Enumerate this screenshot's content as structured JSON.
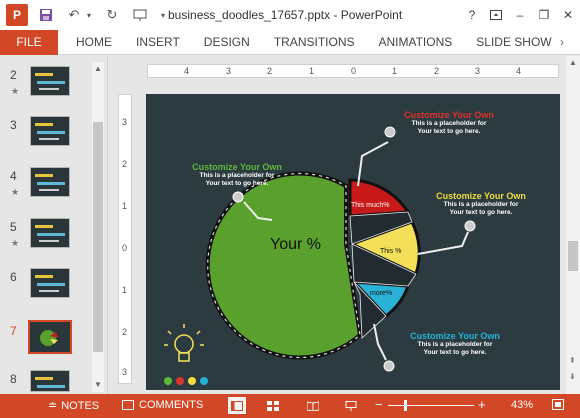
{
  "app": {
    "logo_letter": "P",
    "document_title": "business_doodles_17657.pptx - PowerPoint"
  },
  "window": {
    "help": "?",
    "minimize": "–",
    "restore": "❐",
    "close": "✕"
  },
  "ribbon": {
    "file": "FILE",
    "tabs": [
      "HOME",
      "INSERT",
      "DESIGN",
      "TRANSITIONS",
      "ANIMATIONS",
      "SLIDE SHOW"
    ],
    "more": "›"
  },
  "thumbnails": [
    {
      "number": "2",
      "star": "★"
    },
    {
      "number": "3",
      "star": ""
    },
    {
      "number": "4",
      "star": "★"
    },
    {
      "number": "5",
      "star": "★"
    },
    {
      "number": "6",
      "star": ""
    },
    {
      "number": "7",
      "star": ""
    },
    {
      "number": "8",
      "star": ""
    }
  ],
  "active_slide": "7",
  "ruler": {
    "horizontal": [
      "4",
      "3",
      "2",
      "1",
      "0",
      "1",
      "2",
      "3",
      "4"
    ],
    "vertical": [
      "3",
      "2",
      "1",
      "0",
      "1",
      "2",
      "3"
    ]
  },
  "slide": {
    "center_label": "Your %",
    "slices": {
      "red": "This much%",
      "yellow": "This %",
      "blue": "more%"
    },
    "callouts": {
      "red": {
        "heading": "Customize Your Own",
        "body1": "This is a placeholder for",
        "body2": "Your text to go here.",
        "color": "#e0322e"
      },
      "green": {
        "heading": "Customize Your Own",
        "body1": "This is a placeholder for",
        "body2": "Your text to go here.",
        "color": "#5cb83a"
      },
      "yellow": {
        "heading": "Customize Your Own",
        "body1": "This is a placeholder for",
        "body2": "Your text to go here.",
        "color": "#f1dd3b"
      },
      "blue": {
        "heading": "Customize Your Own",
        "body1": "This is a placeholder for",
        "body2": "Your text to go here.",
        "color": "#22b2d8"
      }
    },
    "dots": [
      "#5cb83a",
      "#e0322e",
      "#f1dd3b",
      "#22b2d8"
    ],
    "colors": {
      "background": "#2c3b40",
      "green": "#5aa02c",
      "red": "#c8191b",
      "yellow": "#f5e05a",
      "blue": "#2ab2d6"
    }
  },
  "status": {
    "notes": "NOTES",
    "comments": "COMMENTS",
    "zoom": "43%",
    "zoom_minus": "−",
    "zoom_plus": "+"
  }
}
